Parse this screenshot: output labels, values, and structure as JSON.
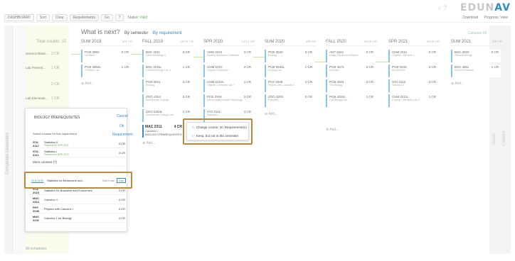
{
  "brand": {
    "logo_a": "EDUN",
    "logo_b": "AV"
  },
  "toolbar": {
    "b1": "DASHBOARD",
    "b2": "Sort",
    "b3": "Clear",
    "b4": "Requirements",
    "b5": "Go",
    "b6": "?",
    "status_label": "Status:",
    "status_value": "Valid",
    "right1": "Download",
    "right2": "Progress: View"
  },
  "sidebar": {
    "left_label": "Completed Semesters",
    "right_label1": "Goals",
    "right_label2": "Careers"
  },
  "header": {
    "title": "What is next?",
    "tab1": "By semester",
    "tab2": "By requirement",
    "collapse": "Collapse All"
  },
  "total_credits": "Total credits: 15",
  "left_rows": [
    {
      "label": "Science Basic...",
      "cr": "2 CR"
    },
    {
      "label": "Lab Present...",
      "cr": "1 CR"
    },
    {
      "label": "",
      "cr": "2 CR"
    },
    {
      "label": "Lab Elements...",
      "cr": "1 CR"
    }
  ],
  "semesters": [
    {
      "name": "SUM 2019",
      "cr": "8/4 CR"
    },
    {
      "name": "FALL 2019",
      "cr": "16/15 CR"
    },
    {
      "name": "SPR 2020",
      "cr": "14/14 CR"
    },
    {
      "name": "SUM 2020",
      "cr": "8/5 CR"
    },
    {
      "name": "FALL 2020",
      "cr": "16/15 CR"
    },
    {
      "name": "SPR 2021",
      "cr": "16/15 CR"
    },
    {
      "name": "SUM 2021",
      "cr": "8/5 CR"
    }
  ],
  "courses": [
    {
      "code": "PCB 3063",
      "cr": "3 CR",
      "desc": "Genetics"
    },
    {
      "code": "PCB 3063L",
      "cr": "1 CR",
      "desc": "Genetics Lab"
    },
    {
      "code": "BSC 2011",
      "cr": "3 CR",
      "desc": "General Biology II"
    },
    {
      "code": "BSC 2011L",
      "cr": "1 CR",
      "desc": "General Biology Lab II"
    },
    {
      "code": "PCB 3041",
      "cr": "3 CR",
      "desc": "Ecology"
    },
    {
      "code": "ZOO 4254",
      "cr": "3 CR",
      "desc": "Invertebrate Zoology"
    },
    {
      "code": "ZOO 4254L",
      "cr": "1 CR",
      "desc": "Invertebrate Zoology Lab"
    },
    {
      "code": "AMH 2042",
      "cr": "3 CR",
      "desc": "Modern American Civilization"
    },
    {
      "code": "CHM 2210",
      "cr": "3 CR",
      "desc": "Organic Chemistry I"
    },
    {
      "code": "CHM 2210L",
      "cr": "1 CR",
      "desc": "Organic Chemistry Lab I"
    },
    {
      "code": "PCB 3703",
      "cr": "3 CR",
      "desc": "Intermediate Human Physiology"
    },
    {
      "code": "STA 3111",
      "cr": "3 CR",
      "desc": "Statistics I"
    },
    {
      "code": "PCB 3043",
      "cr": "3 CR",
      "desc": "Ecology"
    },
    {
      "code": "PCB 3043L",
      "cr": "1 CR",
      "desc": "Ecology Lab"
    },
    {
      "code": "PHY 2049",
      "cr": "4 CR",
      "desc": "Physics with Calculus II"
    },
    {
      "code": "ZOO 3203",
      "cr": "3 CR",
      "desc": "Evolution"
    },
    {
      "code": "ANT 3241",
      "cr": "3 CR",
      "desc": "Magic, Ritual and Religion"
    },
    {
      "code": "PCB 4674",
      "cr": "3 CR",
      "desc": "Evolution"
    },
    {
      "code": "PCB 4024",
      "cr": "3 CR",
      "desc": "Cell Biology"
    },
    {
      "code": "PCB 4024L",
      "cr": "1 CR",
      "desc": "Cell Biology Lab"
    },
    {
      "code": "CHM 2211",
      "cr": "3 CR",
      "desc": "Organic Chemistry II"
    },
    {
      "code": "PCB 3233",
      "cr": "3 CR",
      "desc": "Bio Elective"
    },
    {
      "code": "STA 3112",
      "cr": "3 CR",
      "desc": "Statistics II"
    },
    {
      "code": "CHM 2211L",
      "cr": "1 CR",
      "desc": "Organic Chemistry Lab II"
    },
    {
      "code": "BSC 3033",
      "cr": "3 CR",
      "desc": "General Biology"
    },
    {
      "code": "BSC 4911",
      "cr": "1 CR",
      "desc": "Honors Research"
    }
  ],
  "add_label": "Add...",
  "popup": {
    "title": "BIOLOGY PREREQUISITES",
    "cancel": "Cancel",
    "ok": "Ok",
    "requirement": "Requirement",
    "instructions": "Select courses for this requirement",
    "rows": [
      {
        "code": "STA 3112",
        "title": "Statistics II",
        "note": "Planned for SPR 2021",
        "cr": "3 CR"
      },
      {
        "code": "STA 3111",
        "title": "Statistics I",
        "note": "Planned for SPR 2020",
        "cr": "3 CR"
      }
    ],
    "more": "More courses (7)",
    "highlight": {
      "code": "STA 2122",
      "title": "Statistics for Behavioral and...",
      "dont": "Don't use",
      "use": "Use"
    },
    "rest": [
      {
        "code": "STA 2023",
        "title": "Statistics for Business and Economics",
        "cr": "3 CR"
      },
      {
        "code": "MAC 2312",
        "title": "Calculus II",
        "cr": "4 CR"
      },
      {
        "code": "PHY 2048",
        "title": "Physics with Calculus I",
        "cr": "4 CR"
      },
      {
        "code": "MAC 2241",
        "title": "Calculus 1 for Biology",
        "cr": "4 CR"
      }
    ]
  },
  "mac": {
    "code": "MAC 2311",
    "cr": "4 CR",
    "line1": "Calculus I",
    "line2": "BIOLOGY PREREQUISITES"
  },
  "menu": {
    "item1": "Change course: 3C Requirement(s)",
    "item2": "Keep, but not in this semester"
  },
  "bottom": "All schedules"
}
